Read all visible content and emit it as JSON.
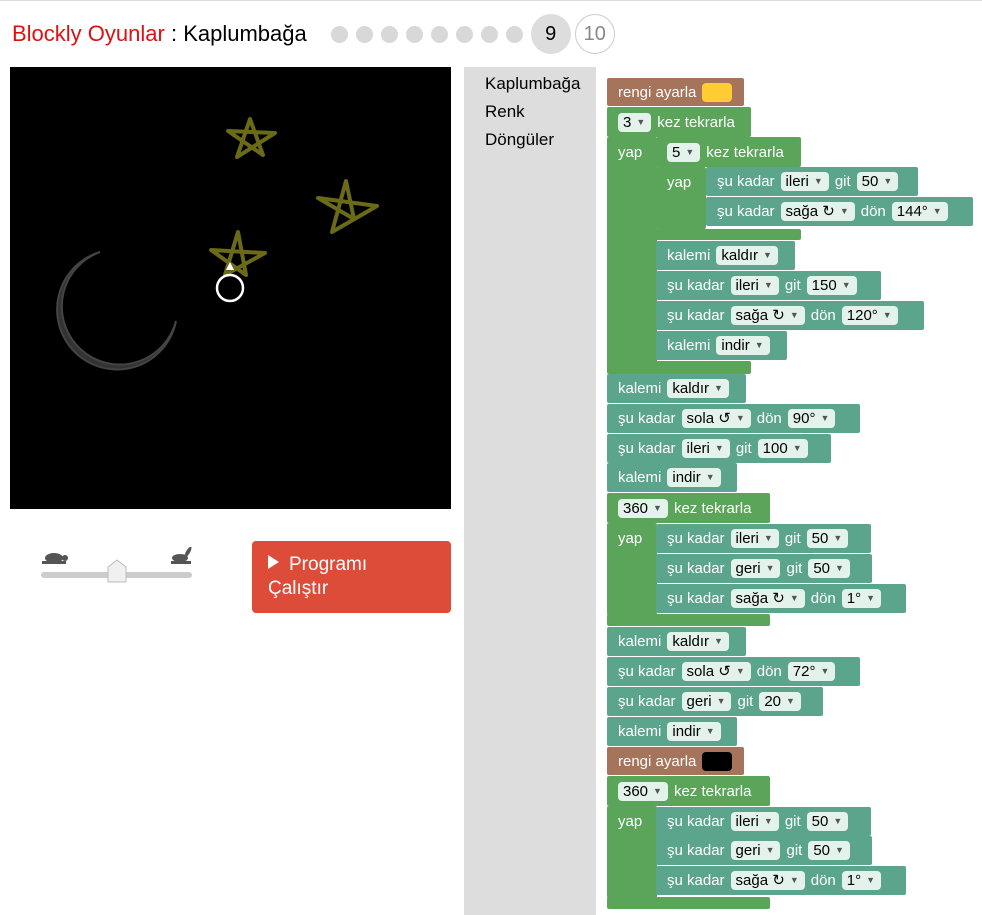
{
  "header": {
    "brand": "Blockly Oyunlar",
    "separator": " : ",
    "game": "Kaplumbağa",
    "current_level": "9",
    "next_level": "10",
    "completed_levels": 8
  },
  "colors": {
    "brand": "#dd1111",
    "run_button": "#dd4b39",
    "colour_block": "#a5745b",
    "loop_block": "#5ba55b",
    "turtle_block": "#5ba58c",
    "star_color": "#ffcc33",
    "final_color": "#000000"
  },
  "canvas": {
    "moon": "crescent-moon",
    "stars": 3,
    "turtle": "turtle-cursor"
  },
  "speed_slider": {
    "value": 0.5,
    "slow_icon": "turtle-icon",
    "fast_icon": "rabbit-icon"
  },
  "run_button": {
    "line1": "Programı",
    "line2": "Çalıştır",
    "icon": "play-icon"
  },
  "toolbox": [
    "Kaplumbağa",
    "Renk",
    "Döngüler"
  ],
  "words": {
    "set_colour": "rengi ayarla",
    "repeat": "kez tekrarla",
    "do": "yap",
    "pen": "kalemi",
    "move": "şu kadar",
    "go": "git",
    "turn": "dön"
  },
  "program": {
    "outer_repeat": "3",
    "inner_repeat": "5",
    "star_dir": "ileri",
    "star_dist": "50",
    "star_turn": "sağa ↻",
    "star_angle": "144°",
    "pen_up_1": "kaldır",
    "move_dir_1": "ileri",
    "move_dist_1": "150",
    "turn_dir_1": "sağa ↻",
    "turn_angle_1": "120°",
    "pen_down_1": "indir",
    "pen_up_2": "kaldır",
    "turn_dir_2": "sola ↺",
    "turn_angle_2": "90°",
    "move_dir_2": "ileri",
    "move_dist_2": "100",
    "pen_down_2": "indir",
    "circle1_repeat": "360",
    "c1_dir_a": "ileri",
    "c1_dist_a": "50",
    "c1_dir_b": "geri",
    "c1_dist_b": "50",
    "c1_turn": "sağa ↻",
    "c1_angle": "1°",
    "pen_up_3": "kaldır",
    "turn_dir_3": "sola ↺",
    "turn_angle_3": "72°",
    "move_dir_3": "geri",
    "move_dist_3": "20",
    "pen_down_3": "indir",
    "circle2_repeat": "360",
    "c2_dir_a": "ileri",
    "c2_dist_a": "50",
    "c2_dir_b": "geri",
    "c2_dist_b": "50",
    "c2_turn": "sağa ↻",
    "c2_angle": "1°"
  }
}
